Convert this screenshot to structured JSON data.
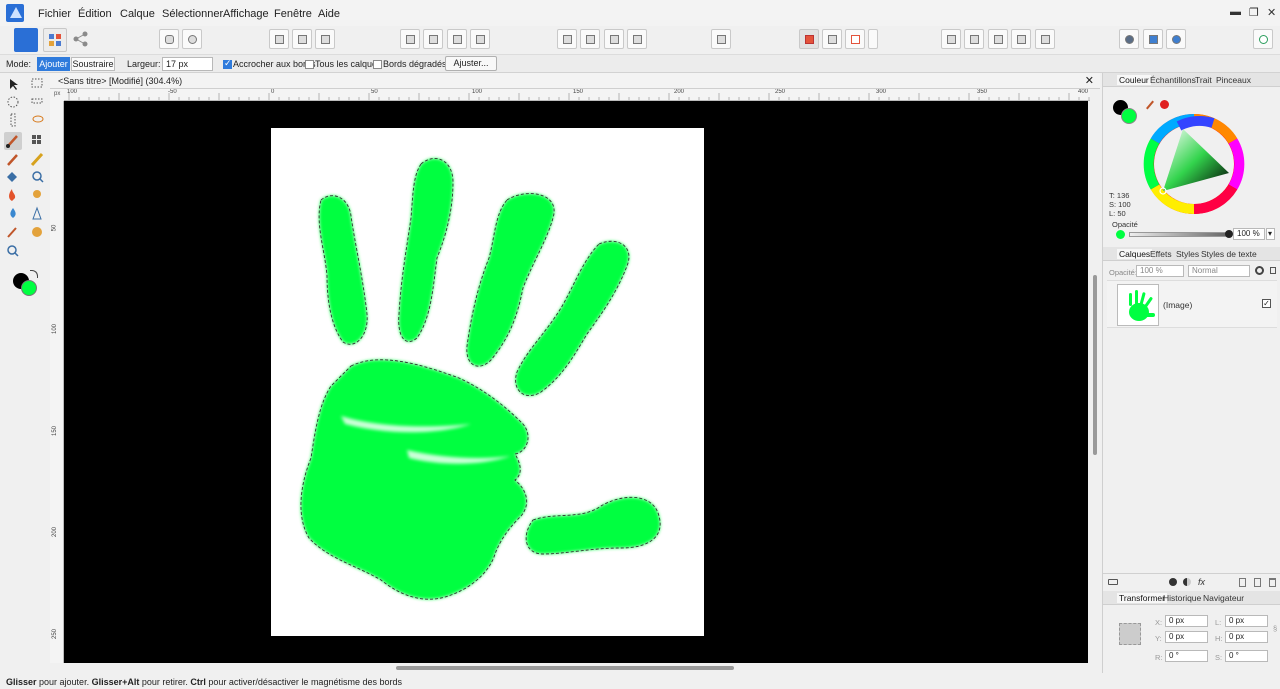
{
  "menu": {
    "items": [
      "Fichier",
      "Édition",
      "Calque",
      "Sélectionner",
      "Affichage",
      "Fenêtre",
      "Aide"
    ]
  },
  "window_controls": {
    "minimize": "▬",
    "restore": "❐",
    "close": "✕"
  },
  "context_bar": {
    "mode_label": "Mode:",
    "add_label": "Ajouter",
    "subtract_label": "Soustraire",
    "width_label": "Largeur:",
    "width_value": "17 px",
    "snap_edges_label": "Accrocher aux bords",
    "snap_edges_checked": true,
    "all_layers_label": "Tous les calques",
    "all_layers_checked": false,
    "soft_edges_label": "Bords dégradés",
    "soft_edges_checked": false,
    "adjust_button": "Ajuster..."
  },
  "document": {
    "tab_title": "<Sans titre> [Modifié] (304.4%)",
    "close_glyph": "✕"
  },
  "rulers": {
    "corner_unit": "px",
    "top_labels": [
      "100",
      "-50",
      "0",
      "50",
      "100",
      "150",
      "200",
      "250",
      "300",
      "350",
      "400"
    ],
    "left_labels": [
      "50",
      "100",
      "150",
      "200",
      "250"
    ]
  },
  "status_bar": {
    "drag_bold": "Glisser",
    "drag_text": " pour ajouter. ",
    "alt_bold": "Glisser+Alt",
    "alt_text": " pour retirer. ",
    "ctrl_bold": "Ctrl",
    "ctrl_text": " pour activer/désactiver le magnétisme des bords"
  },
  "color_panel": {
    "tabs": [
      "Couleur",
      "Échantillons",
      "Trait",
      "Pinceaux"
    ],
    "t_label": "T: 136",
    "s_label": "S: 100",
    "l_label": "L: 50",
    "opacity_label": "Opacité",
    "opacity_value": "100 %",
    "primary_color": "#000000",
    "secondary_color": "#00ff41"
  },
  "layers_panel": {
    "tabs": [
      "Calques",
      "Effets",
      "Styles",
      "Styles de texte"
    ],
    "opacity_label": "Opacité:",
    "opacity_value": "100 %",
    "blend_mode": "Normal",
    "layer_name": "(Image)",
    "layer_visible": true
  },
  "transform_panel": {
    "tabs": [
      "Transformer",
      "Historique",
      "Navigateur"
    ],
    "x_label": "X:",
    "x_value": "0 px",
    "y_label": "Y:",
    "y_value": "0 px",
    "w_label": "L:",
    "w_value": "0 px",
    "h_label": "H:",
    "h_value": "0 px",
    "r_label": "R:",
    "r_value": "0 °",
    "s_label": "S:",
    "s_value": "0 °"
  },
  "colors": {
    "accent": "#2f7bdc",
    "hand": "#00ff41",
    "canvas_bg": "#000000"
  }
}
